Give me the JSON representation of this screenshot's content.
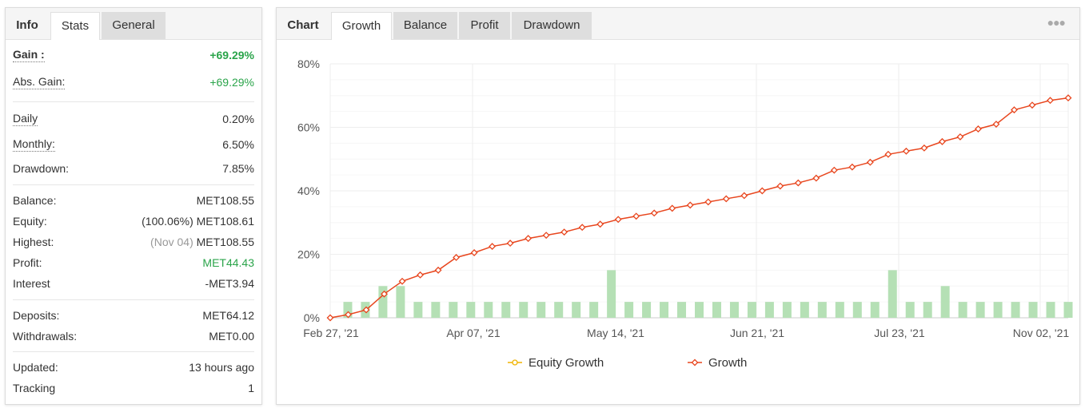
{
  "left_tabs": [
    {
      "label": "Info"
    },
    {
      "label": "Stats"
    },
    {
      "label": "General"
    }
  ],
  "stats": {
    "gain": {
      "label": "Gain :",
      "value": "+69.29%"
    },
    "abs_gain": {
      "label": "Abs. Gain:",
      "value": "+69.29%"
    },
    "daily": {
      "label": "Daily",
      "value": "0.20%"
    },
    "monthly": {
      "label": "Monthly:",
      "value": "6.50%"
    },
    "drawdown": {
      "label": "Drawdown:",
      "value": "7.85%"
    },
    "balance": {
      "label": "Balance:",
      "value": "MET108.55"
    },
    "equity": {
      "label": "Equity:",
      "note": "(100.06%)",
      "value": "MET108.61"
    },
    "highest": {
      "label": "Highest:",
      "note": "(Nov 04)",
      "value": "MET108.55"
    },
    "profit": {
      "label": "Profit:",
      "value": "MET44.43"
    },
    "interest": {
      "label": "Interest",
      "value": "-MET3.94"
    },
    "deposits": {
      "label": "Deposits:",
      "value": "MET64.12"
    },
    "withdrawals": {
      "label": "Withdrawals:",
      "value": "MET0.00"
    },
    "updated": {
      "label": "Updated:",
      "value": "13 hours ago"
    },
    "tracking": {
      "label": "Tracking",
      "value": "1"
    }
  },
  "chart_tabs": [
    {
      "label": "Chart"
    },
    {
      "label": "Growth"
    },
    {
      "label": "Balance"
    },
    {
      "label": "Profit"
    },
    {
      "label": "Drawdown"
    }
  ],
  "menu_icon": "more-dots-icon",
  "colors": {
    "growth_line": "#e8461e",
    "equity_line": "#f0b400",
    "bars": "#b5e0b5",
    "positive": "#2aa44a",
    "grid": "#eeeeee"
  },
  "chart_data": {
    "type": "line",
    "x_ticks": [
      "Feb 27, '21",
      "Apr 07, '21",
      "May 14, '21",
      "Jun 21, '21",
      "Jul 23, '21",
      "Nov 02, '21"
    ],
    "y_ticks": [
      "80%",
      "60%",
      "40%",
      "20%",
      "0%"
    ],
    "ylim": [
      0,
      80
    ],
    "legend_position": "bottom",
    "legend": [
      "Equity Growth",
      "Growth"
    ],
    "grid": true,
    "series": [
      {
        "name": "Growth",
        "type": "line",
        "values": [
          0,
          1,
          2.5,
          7.5,
          11.5,
          13.5,
          15,
          19,
          20.5,
          22.5,
          23.5,
          25,
          26,
          27,
          28.5,
          29.5,
          31,
          32,
          33,
          34.5,
          35.5,
          36.5,
          37.5,
          38.5,
          40,
          41.5,
          42.5,
          44,
          46.5,
          47.5,
          49,
          51.5,
          52.5,
          53.5,
          55.5,
          57,
          59.5,
          61,
          65.5,
          67,
          68.5,
          69.29
        ]
      },
      {
        "name": "",
        "type": "bar",
        "values": [
          0,
          5,
          5,
          10,
          10,
          5,
          5,
          5,
          5,
          5,
          5,
          5,
          5,
          5,
          5,
          5,
          15,
          5,
          5,
          5,
          5,
          5,
          5,
          5,
          5,
          5,
          5,
          5,
          5,
          5,
          5,
          5,
          15,
          5,
          5,
          10,
          5,
          5,
          5,
          5,
          5,
          5,
          5
        ]
      }
    ]
  }
}
